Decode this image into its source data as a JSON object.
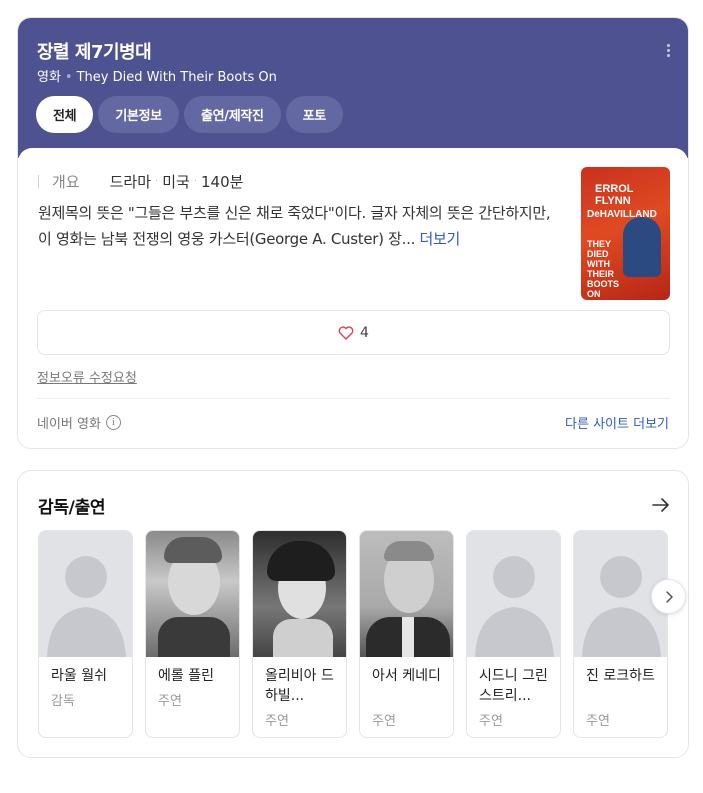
{
  "header": {
    "title": "장렬 제7기병대",
    "category": "영화",
    "original_title": "They Died With Their Boots On",
    "more_icon": "more-vertical-icon"
  },
  "tabs": [
    {
      "label": "전체",
      "active": true
    },
    {
      "label": "기본정보",
      "active": false
    },
    {
      "label": "출연/제작진",
      "active": false
    },
    {
      "label": "포토",
      "active": false
    }
  ],
  "overview": {
    "label": "개요",
    "genre": "드라마",
    "country": "미국",
    "runtime": "140분",
    "description": "원제목의 뜻은 \"그들은 부츠를 신은 채로 죽었다\"이다. 글자 자체의 뜻은 간단하지만, 이 영화는 남북 전쟁의 영웅 카스터(George A. Custer) 장...",
    "more_label": "더보기"
  },
  "poster": {
    "line1": "ERROL FLYNN",
    "line2": "DeHAVILLAND",
    "line3": "THEY DIED WITH THEIR BOOTS ON"
  },
  "like": {
    "icon": "heart-icon",
    "count": "4",
    "color": "#e0434b"
  },
  "report_label": "정보오류 수정요청",
  "source_label": "네이버 영화",
  "other_sites_label": "다른 사이트 더보기",
  "cast_section": {
    "title": "감독/출연",
    "people": [
      {
        "name": "라울 월쉬",
        "role": "감독",
        "photo": false
      },
      {
        "name": "에롤 플린",
        "role": "주연",
        "photo": true
      },
      {
        "name": "올리비아 드 하빌...",
        "role": "주연",
        "photo": true
      },
      {
        "name": "아서 케네디",
        "role": "주연",
        "photo": true
      },
      {
        "name": "시드니 그린스트리...",
        "role": "주연",
        "photo": false
      },
      {
        "name": "진 로크하트",
        "role": "주연",
        "photo": false
      }
    ]
  },
  "colors": {
    "header_bg": "#4f5290",
    "tab_bg": "#6468a2",
    "link": "#2f5bbc"
  }
}
